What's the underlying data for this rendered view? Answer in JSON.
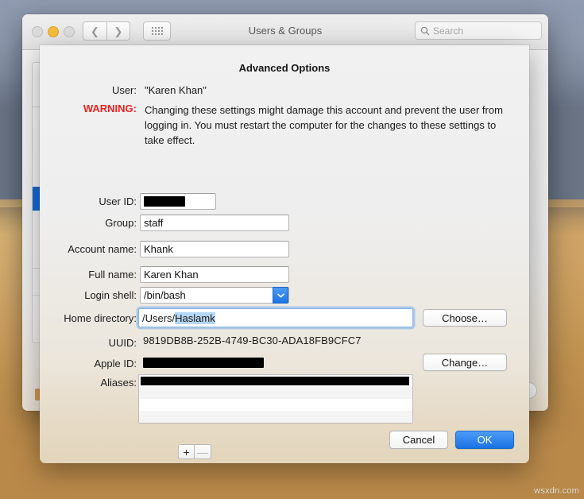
{
  "window": {
    "title": "Users & Groups",
    "traffic_lights": [
      "close-button",
      "minimize-button",
      "zoom-button"
    ],
    "nav": {
      "back": "‹",
      "forward": "›",
      "grid": "grid-icon"
    },
    "search": {
      "placeholder": "Search",
      "value": "",
      "icon": "search-icon"
    }
  },
  "sheet": {
    "title": "Advanced Options",
    "user": {
      "label": "User:",
      "value": "\"Karen Khan\""
    },
    "warning": {
      "label": "WARNING:",
      "text": "Changing these settings might damage this account and prevent the user from logging in. You must restart the computer for the changes to these settings to take effect.",
      "color": "#f02020"
    },
    "fields": {
      "user_id": {
        "label": "User ID:",
        "value": "",
        "redacted": true
      },
      "group": {
        "label": "Group:",
        "value": "staff"
      },
      "account": {
        "label": "Account name:",
        "value": "Khank"
      },
      "full_name": {
        "label": "Full name:",
        "value": "Karen Khan"
      },
      "shell": {
        "label": "Login shell:",
        "value": "/bin/bash",
        "arrow_icon": "chevron-down-icon"
      },
      "home": {
        "label": "Home directory:",
        "value_prefix": "/Users/",
        "value_selected": "Haslamk",
        "focused": true
      },
      "uuid": {
        "label": "UUID:",
        "value": "9819DB8B-252B-4749-BC30-ADA18FB9CFC7"
      },
      "apple_id": {
        "label": "Apple ID:",
        "value": "",
        "redacted": true
      },
      "aliases": {
        "label": "Aliases:",
        "rows": [
          "",
          "",
          "",
          ""
        ],
        "first_row_redacted": true
      }
    },
    "buttons": {
      "choose": "Choose…",
      "change": "Change…",
      "cancel": "Cancel",
      "ok": "OK",
      "add": "+",
      "remove": "—"
    },
    "accent_color": "#1a72e2"
  },
  "watermark": "wsxdn.com"
}
